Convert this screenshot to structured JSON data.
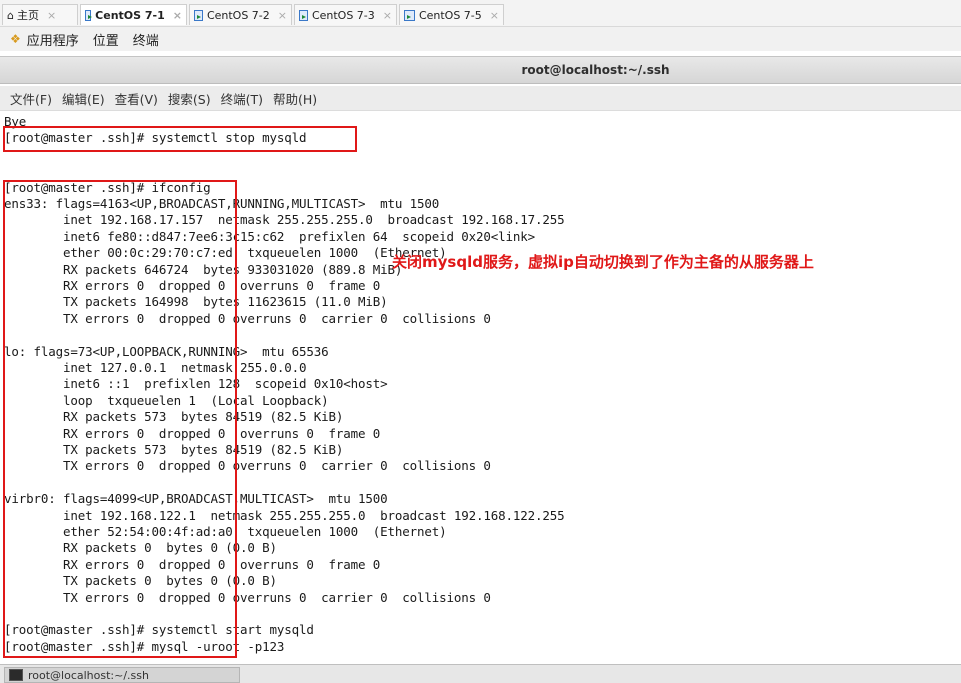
{
  "tabs": [
    {
      "label": "主页",
      "icon": "home-icon",
      "active": false
    },
    {
      "label": "CentOS 7-1",
      "icon": "vm-icon",
      "active": true
    },
    {
      "label": "CentOS 7-2",
      "icon": "vm-icon",
      "active": false
    },
    {
      "label": "CentOS 7-3",
      "icon": "vm-icon",
      "active": false
    },
    {
      "label": "CentOS 7-5",
      "icon": "vm-icon",
      "active": false
    }
  ],
  "appbar": {
    "applications": "应用程序",
    "places": "位置",
    "terminal": "终端"
  },
  "window_title": "root@localhost:~/.ssh",
  "terminal_menu": [
    "文件(F)",
    "编辑(E)",
    "查看(V)",
    "搜索(S)",
    "终端(T)",
    "帮助(H)"
  ],
  "terminal_lines": [
    "Bye",
    "[root@master .ssh]# systemctl stop mysqld",
    "",
    "",
    "[root@master .ssh]# ifconfig",
    "ens33: flags=4163<UP,BROADCAST,RUNNING,MULTICAST>  mtu 1500",
    "        inet 192.168.17.157  netmask 255.255.255.0  broadcast 192.168.17.255",
    "        inet6 fe80::d847:7ee6:3c15:c62  prefixlen 64  scopeid 0x20<link>",
    "        ether 00:0c:29:70:c7:ed  txqueuelen 1000  (Ethernet)",
    "        RX packets 646724  bytes 933031020 (889.8 MiB)",
    "        RX errors 0  dropped 0  overruns 0  frame 0",
    "        TX packets 164998  bytes 11623615 (11.0 MiB)",
    "        TX errors 0  dropped 0 overruns 0  carrier 0  collisions 0",
    "",
    "lo: flags=73<UP,LOOPBACK,RUNNING>  mtu 65536",
    "        inet 127.0.0.1  netmask 255.0.0.0",
    "        inet6 ::1  prefixlen 128  scopeid 0x10<host>",
    "        loop  txqueuelen 1  (Local Loopback)",
    "        RX packets 573  bytes 84519 (82.5 KiB)",
    "        RX errors 0  dropped 0  overruns 0  frame 0",
    "        TX packets 573  bytes 84519 (82.5 KiB)",
    "        TX errors 0  dropped 0 overruns 0  carrier 0  collisions 0",
    "",
    "virbr0: flags=4099<UP,BROADCAST,MULTICAST>  mtu 1500",
    "        inet 192.168.122.1  netmask 255.255.255.0  broadcast 192.168.122.255",
    "        ether 52:54:00:4f:ad:a0  txqueuelen 1000  (Ethernet)",
    "        RX packets 0  bytes 0 (0.0 B)",
    "        RX errors 0  dropped 0  overruns 0  frame 0",
    "        TX packets 0  bytes 0 (0.0 B)",
    "        TX errors 0  dropped 0 overruns 0  carrier 0  collisions 0",
    "",
    "[root@master .ssh]# systemctl start mysqld",
    "[root@master .ssh]# mysql -uroot -p123"
  ],
  "annotation": "关闭mysqld服务，虚拟ip自动切换到了作为主备的从服务器上",
  "taskbar_item": "root@localhost:~/.ssh",
  "colors": {
    "annotation_red": "#e01818",
    "terminal_bg": "#ffffff",
    "terminal_fg": "#1a1a1a"
  }
}
